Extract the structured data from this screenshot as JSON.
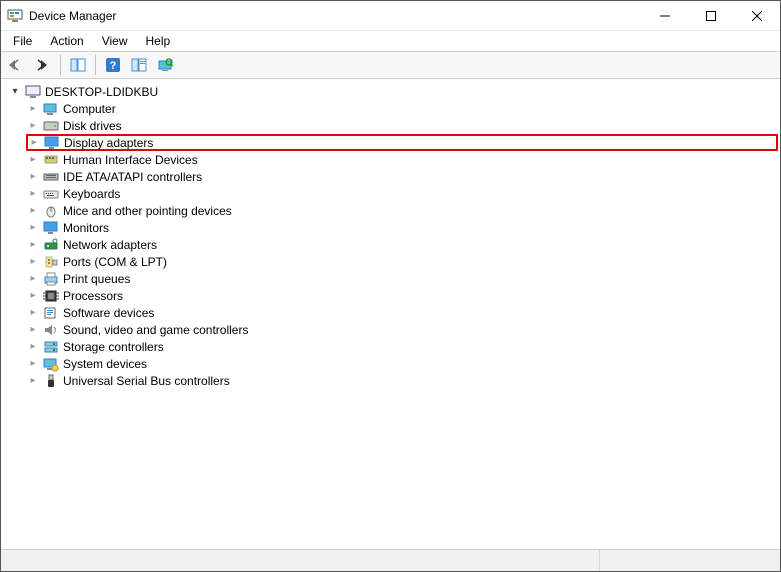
{
  "window": {
    "title": "Device Manager"
  },
  "menu": {
    "file": "File",
    "action": "Action",
    "view": "View",
    "help": "Help"
  },
  "toolbar": {
    "back": "back-icon",
    "forward": "forward-icon",
    "showhide": "showhide-icon",
    "help": "help-icon",
    "properties": "properties-icon",
    "scan": "scan-icon"
  },
  "tree": {
    "root": "DESKTOP-LDIDKBU",
    "items": [
      {
        "label": "Computer",
        "icon": "computer"
      },
      {
        "label": "Disk drives",
        "icon": "disk"
      },
      {
        "label": "Display adapters",
        "icon": "display",
        "highlight": true
      },
      {
        "label": "Human Interface Devices",
        "icon": "hid"
      },
      {
        "label": "IDE ATA/ATAPI controllers",
        "icon": "ide"
      },
      {
        "label": "Keyboards",
        "icon": "keyboard"
      },
      {
        "label": "Mice and other pointing devices",
        "icon": "mouse"
      },
      {
        "label": "Monitors",
        "icon": "monitor"
      },
      {
        "label": "Network adapters",
        "icon": "network"
      },
      {
        "label": "Ports (COM & LPT)",
        "icon": "ports"
      },
      {
        "label": "Print queues",
        "icon": "printer"
      },
      {
        "label": "Processors",
        "icon": "cpu"
      },
      {
        "label": "Software devices",
        "icon": "software"
      },
      {
        "label": "Sound, video and game controllers",
        "icon": "sound"
      },
      {
        "label": "Storage controllers",
        "icon": "storage"
      },
      {
        "label": "System devices",
        "icon": "system"
      },
      {
        "label": "Universal Serial Bus controllers",
        "icon": "usb"
      }
    ]
  }
}
